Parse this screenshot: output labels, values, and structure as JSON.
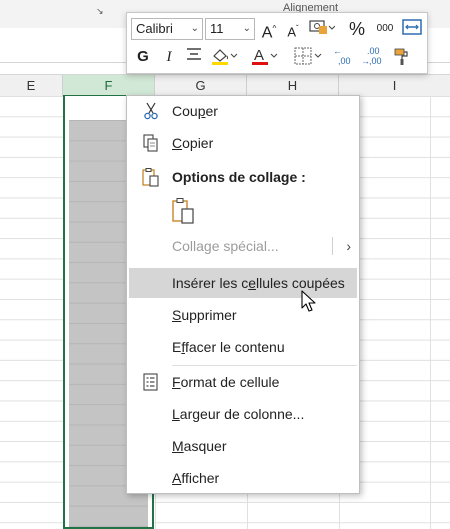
{
  "ribbon": {
    "group_label": "Alignement"
  },
  "columns": [
    {
      "name": "E"
    },
    {
      "name": "F"
    },
    {
      "name": "G"
    },
    {
      "name": "H"
    },
    {
      "name": "I"
    }
  ],
  "mini_toolbar": {
    "font_name": "Calibri",
    "font_size": "11",
    "percent": "%",
    "thousands": "000",
    "bold": "G",
    "italic": "I",
    "increase_decimal": ",00",
    "decrease_decimal": ",00"
  },
  "context_menu": {
    "cut_pre": "Cou",
    "cut_u": "p",
    "cut_post": "er",
    "copy_pre": "",
    "copy_u": "C",
    "copy_post": "opier",
    "paste_options": "Options de collage :",
    "paste_special": "Collage spécial...",
    "insert_pre": "Insérer les c",
    "insert_u": "e",
    "insert_post": "llules coupées",
    "delete_pre": "",
    "delete_u": "S",
    "delete_post": "upprimer",
    "clear_pre": "E",
    "clear_u": "f",
    "clear_post": "facer le contenu",
    "format_pre": "",
    "format_u": "F",
    "format_post": "ormat de cellule",
    "width_pre": "",
    "width_u": "L",
    "width_post": "argeur de colonne...",
    "hide_pre": "",
    "hide_u": "M",
    "hide_post": "asquer",
    "unhide_pre": "",
    "unhide_u": "A",
    "unhide_post": "fficher"
  },
  "colors": {
    "selection_green": "#217346",
    "highlight_fill": "#ffd800",
    "font_color_red": "#e01010",
    "menu_hover": "#d6d6d6"
  }
}
